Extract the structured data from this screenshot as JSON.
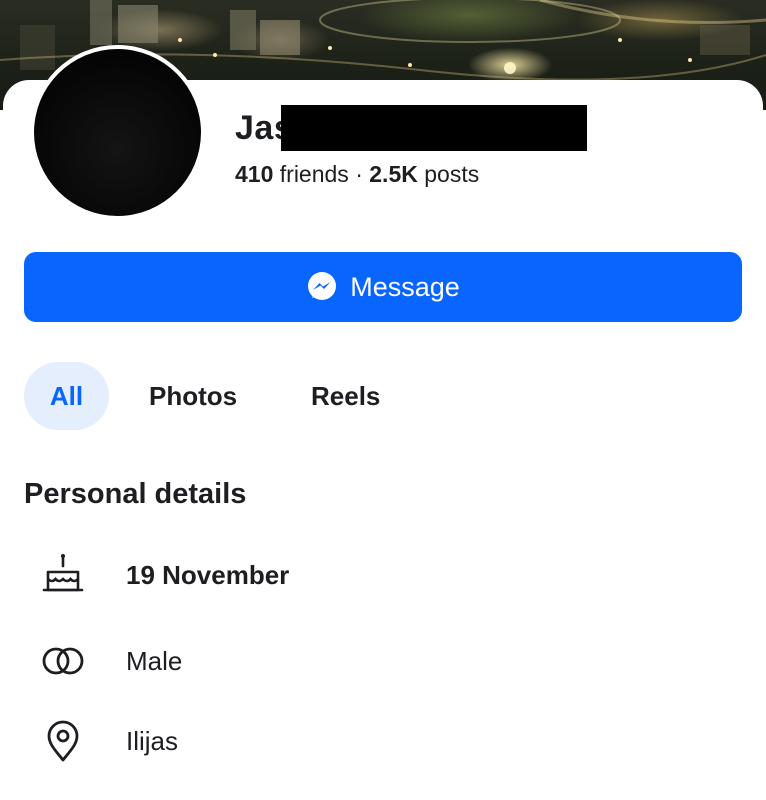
{
  "colors": {
    "accent": "#0866ff",
    "accent_tab_bg": "#e4eefc",
    "text": "#1c1e21",
    "redaction": "#000000"
  },
  "profile": {
    "name_visible": "Jas",
    "name_redacted": true,
    "friends_count": "410",
    "friends_label": " friends",
    "separator": " · ",
    "posts_count": "2.5K",
    "posts_label": " posts",
    "avatar_icon": "profile-avatar"
  },
  "actions": {
    "message_label": "Message",
    "message_icon": "messenger-icon"
  },
  "tabs": [
    {
      "label": "All",
      "selected": true
    },
    {
      "label": "Photos",
      "selected": false
    },
    {
      "label": "Reels",
      "selected": false
    }
  ],
  "personal_details": {
    "title": "Personal details",
    "items": [
      {
        "icon": "birthday-cake-icon",
        "text": "19 November"
      },
      {
        "icon": "gender-rings-icon",
        "text": "Male"
      },
      {
        "icon": "location-pin-icon",
        "text": "Ilijas"
      }
    ]
  }
}
